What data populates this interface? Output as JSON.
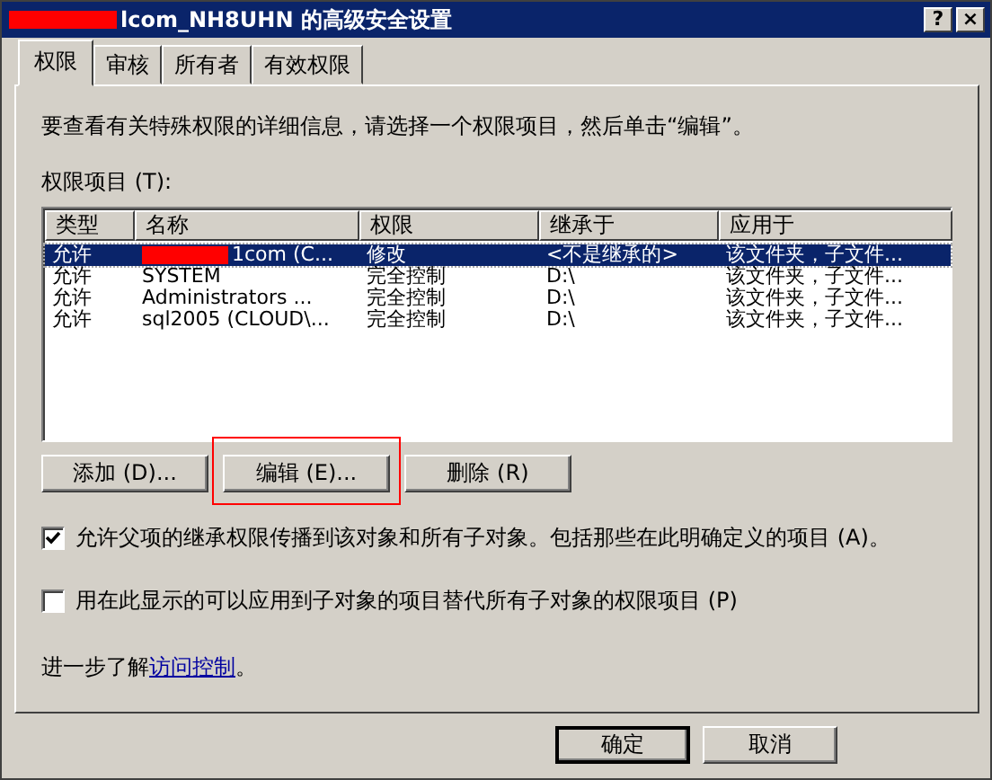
{
  "window": {
    "title": "lcom_NH8UHN 的高级安全设置",
    "title_redacted": true,
    "buttons": [
      "?",
      "×"
    ]
  },
  "tabs": [
    {
      "label": "权限",
      "selected": true
    },
    {
      "label": "审核",
      "selected": false
    },
    {
      "label": "所有者",
      "selected": false
    },
    {
      "label": "有效权限",
      "selected": false
    }
  ],
  "intro": "要查看有关特殊权限的详细信息，请选择一个权限项目，然后单击“编辑”。",
  "list_label": "权限项目 (T):",
  "table": {
    "columns": [
      "类型",
      "名称",
      "权限",
      "继承于",
      "应用于"
    ],
    "rows": [
      {
        "cells": [
          "允许",
          "1com (C...",
          "修改",
          "<不是继承的>",
          "该文件夹，子文件..."
        ],
        "redacted": true,
        "selected": true
      },
      {
        "cells": [
          "允许",
          "SYSTEM",
          "完全控制",
          "D:\\",
          "该文件夹，子文件..."
        ],
        "redacted": false,
        "selected": false
      },
      {
        "cells": [
          "允许",
          "Administrators ...",
          "完全控制",
          "D:\\",
          "该文件夹，子文件..."
        ],
        "redacted": false,
        "selected": false
      },
      {
        "cells": [
          "允许",
          "sql2005 (CLOUD\\...",
          "完全控制",
          "D:\\",
          "该文件夹，子文件..."
        ],
        "redacted": false,
        "selected": false
      }
    ]
  },
  "actions": [
    {
      "label": "添加 (D)...",
      "highlighted": false
    },
    {
      "label": "编辑 (E)...",
      "highlighted": true
    },
    {
      "label": "删除 (R)",
      "highlighted": false
    }
  ],
  "options": [
    {
      "label": "允许父项的继承权限传播到该对象和所有子对象。包括那些在此明确定义的项目 (A)。",
      "checked": true
    },
    {
      "label": "用在此显示的可以应用到子对象的项目替代所有子对象的权限项目 (P)",
      "checked": false
    }
  ],
  "footer": {
    "text": "进一步了解",
    "link": "访问控制",
    "end": "。"
  },
  "buttons": [
    {
      "label": "确定",
      "default": true
    },
    {
      "label": "取消",
      "default": false
    }
  ]
}
